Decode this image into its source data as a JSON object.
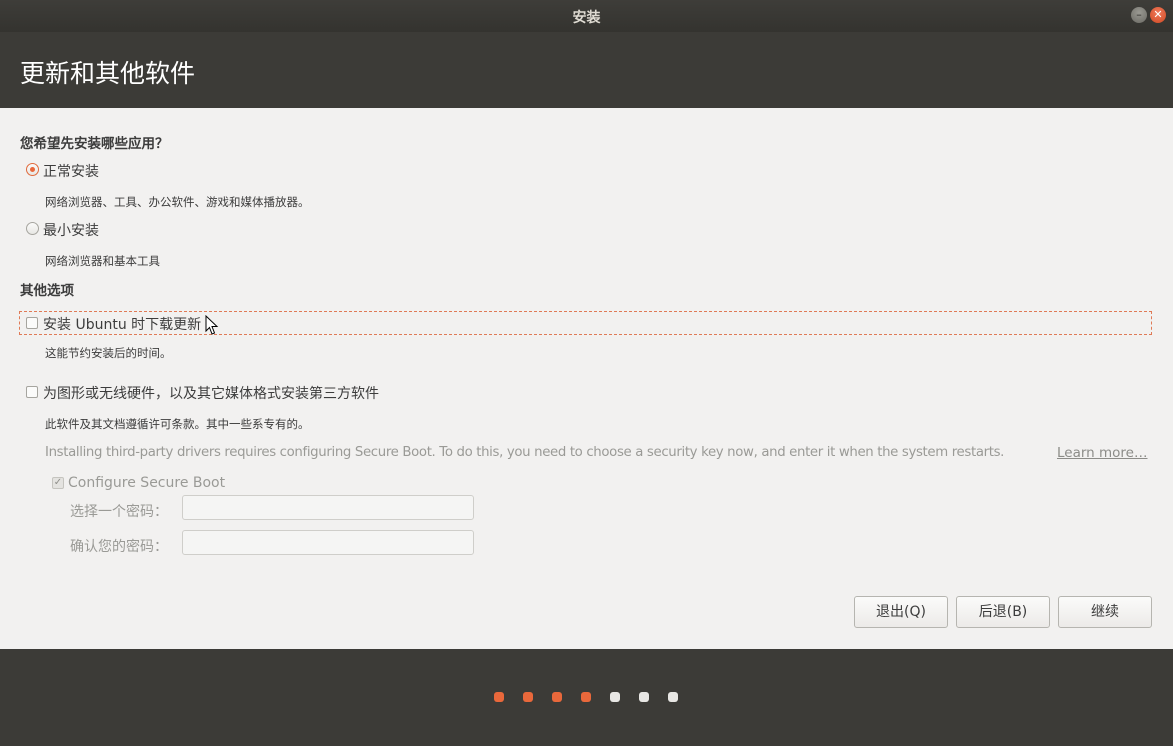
{
  "window": {
    "title": "安装"
  },
  "header": {
    "title": "更新和其他软件"
  },
  "install_type": {
    "question": "您希望先安装哪些应用？",
    "normal": {
      "label": "正常安装",
      "desc": "网络浏览器、工具、办公软件、游戏和媒体播放器。",
      "selected": true
    },
    "minimal": {
      "label": "最小安装",
      "desc": "网络浏览器和基本工具",
      "selected": false
    }
  },
  "other_options": {
    "heading": "其他选项",
    "download_updates": {
      "label": "安装 Ubuntu 时下载更新",
      "desc": "这能节约安装后的时间。",
      "checked": false
    },
    "third_party": {
      "label": "为图形或无线硬件，以及其它媒体格式安装第三方软件",
      "desc": "此软件及其文档遵循许可条款。其中一些系专有的。",
      "secure_boot_note": "Installing third-party drivers requires configuring Secure Boot. To do this, you need to choose a security key now, and enter it when the system restarts.",
      "learn_more": "Learn more…",
      "checked": false
    },
    "secure_boot": {
      "label": "Configure Secure Boot",
      "checked": true,
      "password_label": "选择一个密码：",
      "password_value": "",
      "confirm_label": "确认您的密码：",
      "confirm_value": ""
    }
  },
  "buttons": {
    "quit": "退出(Q)",
    "back": "后退(B)",
    "continue": "继续"
  },
  "progress": {
    "total_steps": 7,
    "completed_steps": 4,
    "active_color": "#e9683b",
    "inactive_color": "#e8e7e4"
  },
  "colors": {
    "accent": "#e9683b",
    "header_bg": "#3c3b37",
    "content_bg": "#f2f1f0"
  }
}
